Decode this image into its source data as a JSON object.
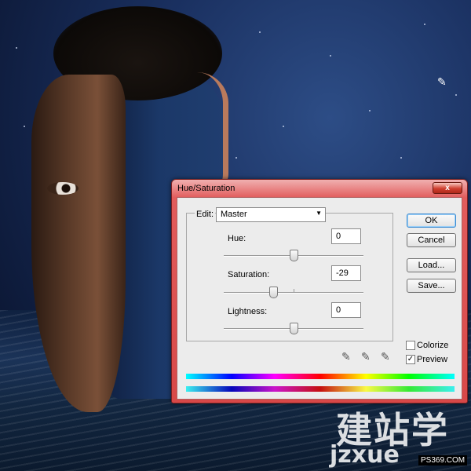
{
  "dialog": {
    "title": "Hue/Saturation",
    "close_glyph": "x",
    "edit": {
      "label": "Edit:",
      "value": "Master"
    },
    "hue": {
      "label": "Hue:",
      "value": "0",
      "level": 0
    },
    "saturation": {
      "label": "Saturation:",
      "value": "-29",
      "level": -29
    },
    "lightness": {
      "label": "Lightness:",
      "value": "0",
      "level": 0
    },
    "buttons": {
      "ok": "OK",
      "cancel": "Cancel",
      "load": "Load...",
      "save": "Save..."
    },
    "colorize": {
      "label": "Colorize",
      "checked": false
    },
    "preview": {
      "label": "Preview",
      "checked": true,
      "mark": "✓"
    }
  },
  "watermark": {
    "brand": "建站学",
    "domain": "jzxue",
    "site": "PS369.COM"
  },
  "icons": {
    "eyedropper": "eyedropper-icon",
    "eyedropper_plus": "eyedropper-plus-icon",
    "eyedropper_minus": "eyedropper-minus-icon",
    "dropdown": "chevron-down-icon"
  }
}
